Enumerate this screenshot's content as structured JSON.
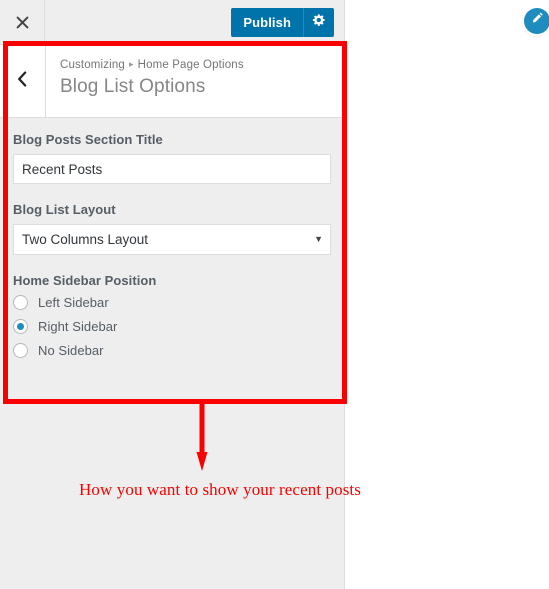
{
  "topbar": {
    "close_label": "close-icon",
    "publish_label": "Publish",
    "settings_label": "gear-icon"
  },
  "header": {
    "back_label": "back-chevron-icon",
    "breadcrumb_root": "Customizing",
    "breadcrumb_separator": "▸",
    "breadcrumb_current": "Home Page Options",
    "title": "Blog List Options"
  },
  "controls": {
    "section_title": {
      "label": "Blog Posts Section Title",
      "value": "Recent Posts",
      "placeholder": ""
    },
    "layout": {
      "label": "Blog List Layout",
      "value": "Two Columns Layout",
      "arrow": "▼",
      "options": [
        "Two Columns Layout"
      ]
    },
    "sidebar_position": {
      "label": "Home Sidebar Position",
      "options": [
        {
          "label": "Left Sidebar",
          "checked": false
        },
        {
          "label": "Right Sidebar",
          "checked": true
        },
        {
          "label": "No Sidebar",
          "checked": false
        }
      ]
    }
  },
  "annotation": {
    "text": "How you want to show your recent posts",
    "color": "#fb0000"
  },
  "edit_bubble": {
    "label": "pencil-icon"
  },
  "colors": {
    "accent": "#0073aa",
    "radio_selected": "#1e8cbe",
    "panel_bg": "#eeeeee",
    "annotation": "#fb0000"
  }
}
